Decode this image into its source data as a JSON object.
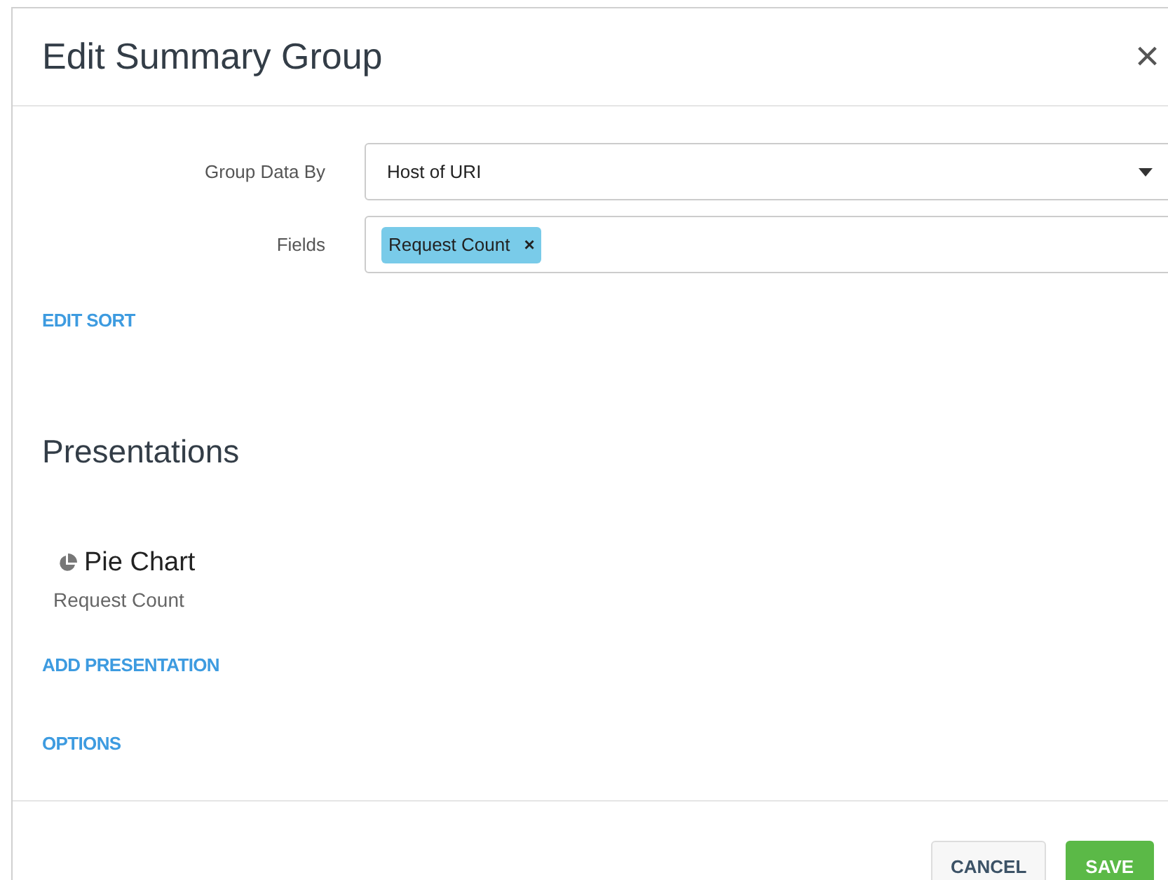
{
  "dialog": {
    "title": "Edit Summary Group",
    "close": "×"
  },
  "form": [
    {
      "kind": "select",
      "label": "Group Data By",
      "value": "Host of URI"
    },
    {
      "kind": "tags",
      "label": "Fields",
      "tags": [
        {
          "label": "Request Count",
          "remove": "×"
        }
      ]
    }
  ],
  "edit_sort": "EDIT SORT",
  "presentations": {
    "heading": "Presentations",
    "items": [
      {
        "title": "Pie Chart",
        "subtitle": "Request Count"
      }
    ],
    "add": "ADD PRESENTATION"
  },
  "options": "OPTIONS",
  "buttons": [
    {
      "label": "CANCEL",
      "kind": "secondary"
    },
    {
      "label": "SAVE",
      "kind": "primary"
    }
  ]
}
